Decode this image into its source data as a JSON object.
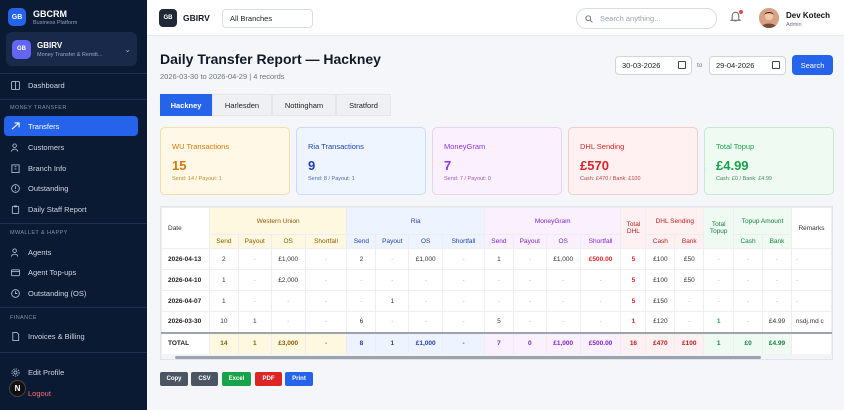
{
  "sidebar": {
    "brand": {
      "name": "GBCRM",
      "subtitle": "Business Platform",
      "logo": "GB"
    },
    "business": {
      "name": "GBIRV",
      "subtitle": "Money Transfer & Remitt...",
      "logo": "GB"
    },
    "sections": {
      "money_transfer": "MONEY TRANSFER",
      "mwallet": "MWALLET & HAPPY",
      "finance": "FINANCE"
    },
    "items": {
      "dashboard": "Dashboard",
      "transfers": "Transfers",
      "customers": "Customers",
      "branch_info": "Branch Info",
      "outstanding": "Outstanding",
      "daily_staff_report": "Daily Staff Report",
      "agents": "Agents",
      "agent_topups": "Agent Top-ups",
      "outstanding_os": "Outstanding (OS)",
      "invoices": "Invoices & Billing",
      "edit_profile": "Edit Profile",
      "logout": "Logout"
    },
    "avatar_letter": "N"
  },
  "topbar": {
    "logo": "GB",
    "name": "GBIRV",
    "branch_select": "All Branches",
    "search_placeholder": "Search anything...",
    "user_name": "Dev Kotech",
    "user_role": "Admin"
  },
  "page": {
    "title": "Daily Transfer Report — Hackney",
    "subtitle": "2026-03-30 to 2026-04-29 | 4 records"
  },
  "filters": {
    "from": "30-03-2026",
    "to_label": "to",
    "to": "29-04-2026",
    "search_button": "Search"
  },
  "tabs": [
    "Hackney",
    "Harlesden",
    "Nottingham",
    "Stratford"
  ],
  "cards": [
    {
      "label": "WU Transactions",
      "value": "15",
      "sub": "Send: 14 / Payout: 1",
      "bg": "#fff8e6",
      "border": "#f5dfa8",
      "color": "#d97706",
      "subcolor": "#c08a2b"
    },
    {
      "label": "Ria Transactions",
      "value": "9",
      "sub": "Send: 8 / Payout: 1",
      "bg": "#eef5ff",
      "border": "#c9dcfb",
      "color": "#1e40af",
      "subcolor": "#4b6aa8"
    },
    {
      "label": "MoneyGram",
      "value": "7",
      "sub": "Send: 7 / Payout: 0",
      "bg": "#fbf0fd",
      "border": "#ecd2f3",
      "color": "#9333ea",
      "subcolor": "#9b5cb4"
    },
    {
      "label": "DHL Sending",
      "value": "£570",
      "sub": "Cash: £470 / Bank: £100",
      "bg": "#fff1f1",
      "border": "#f6cccc",
      "color": "#dc2626",
      "subcolor": "#b24444"
    },
    {
      "label": "Total Topup",
      "value": "£4.99",
      "sub": "Cash: £0 / Bank: £4.99",
      "bg": "#effbf2",
      "border": "#c4ebcf",
      "color": "#16a34a",
      "subcolor": "#3f8a56"
    }
  ],
  "table": {
    "date_header": "Date",
    "groups": {
      "wu": "Western Union",
      "ria": "Ria",
      "mg": "MoneyGram",
      "total_dhl": "Total DHL",
      "dhl": "DHL Sending",
      "total_topup": "Total Topup",
      "topup_amount": "Topup Amount",
      "remarks": "Remarks"
    },
    "subheaders": [
      "Send",
      "Payout",
      "OS",
      "Shortfall",
      "Send",
      "Payout",
      "OS",
      "Shortfall",
      "Send",
      "Payout",
      "OS",
      "Shortfall",
      "Cash",
      "Bank",
      "Cash",
      "Bank"
    ],
    "rows": [
      [
        "2026-04-13",
        "2",
        "-",
        "£1,000",
        "-",
        "2",
        "-",
        "£1,000",
        "-",
        "1",
        "-",
        "£1,000",
        "£500.00",
        "5",
        "£100",
        "£50",
        "-",
        "-",
        "-",
        "-"
      ],
      [
        "2026-04-10",
        "1",
        "-",
        "£2,000",
        "-",
        "-",
        "-",
        "-",
        "-",
        "-",
        "-",
        "-",
        "-",
        "5",
        "£100",
        "£50",
        "-",
        "-",
        "-",
        "-"
      ],
      [
        "2026-04-07",
        "1",
        "-",
        "-",
        "-",
        "-",
        "1",
        "-",
        "-",
        "-",
        "-",
        "-",
        "-",
        "5",
        "£150",
        "-",
        "-",
        "-",
        "-",
        "-"
      ],
      [
        "2026-03-30",
        "10",
        "1",
        "-",
        "-",
        "6",
        "-",
        "-",
        "-",
        "5",
        "-",
        "-",
        "-",
        "1",
        "£120",
        "-",
        "1",
        "-",
        "£4.99",
        "nsdj.md c"
      ]
    ],
    "total": [
      "TOTAL",
      "14",
      "1",
      "£3,000",
      "-",
      "8",
      "1",
      "£1,000",
      "-",
      "7",
      "0",
      "£1,000",
      "£500.00",
      "16",
      "£470",
      "£100",
      "1",
      "£0",
      "£4.99",
      ""
    ]
  },
  "export_buttons": [
    {
      "label": "Copy",
      "color": "#4b5563"
    },
    {
      "label": "CSV",
      "color": "#4b5563"
    },
    {
      "label": "Excel",
      "color": "#16a34a"
    },
    {
      "label": "PDF",
      "color": "#dc2626"
    },
    {
      "label": "Print",
      "color": "#2563eb"
    }
  ]
}
